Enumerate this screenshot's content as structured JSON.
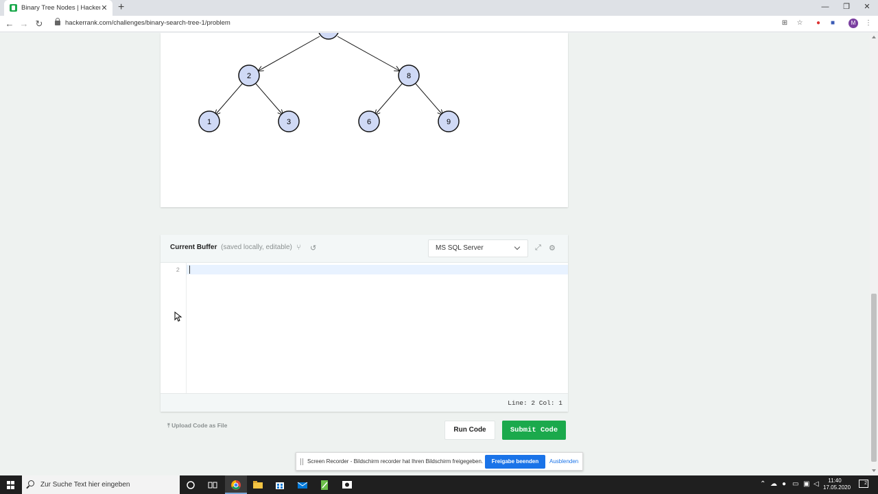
{
  "browser": {
    "tab_title": "Binary Tree Nodes | HackerRank",
    "tab_close": "✕",
    "new_tab": "+",
    "url": "hackerrank.com/challenges/binary-search-tree-1/problem",
    "avatar_letter": "M",
    "window_controls": [
      "—",
      "❐",
      "✕"
    ]
  },
  "tree": {
    "nodes": [
      "2",
      "8",
      "1",
      "3",
      "6",
      "9"
    ]
  },
  "editor": {
    "title": "Current Buffer",
    "subtitle": "(saved locally, editable)",
    "language": "MS SQL Server",
    "line_number": "2",
    "status": "Line: 2 Col: 1"
  },
  "actions": {
    "upload_label": "Upload Code as File",
    "run_label": "Run Code",
    "submit_label": "Submit Code"
  },
  "recorder": {
    "message": "Screen Recorder - Bildschirm recorder hat Ihren Bildschirm freigegeben.",
    "stop_label": "Freigabe beenden",
    "hide_label": "Ausblenden"
  },
  "taskbar": {
    "search_placeholder": "Zur Suche Text hier eingeben",
    "time": "11:40",
    "date": "17.05.2020",
    "notification_count": "2"
  },
  "colors": {
    "accent_green": "#1ba94c",
    "node_fill": "#cfd9f5",
    "recorder_blue": "#1a73e8"
  }
}
